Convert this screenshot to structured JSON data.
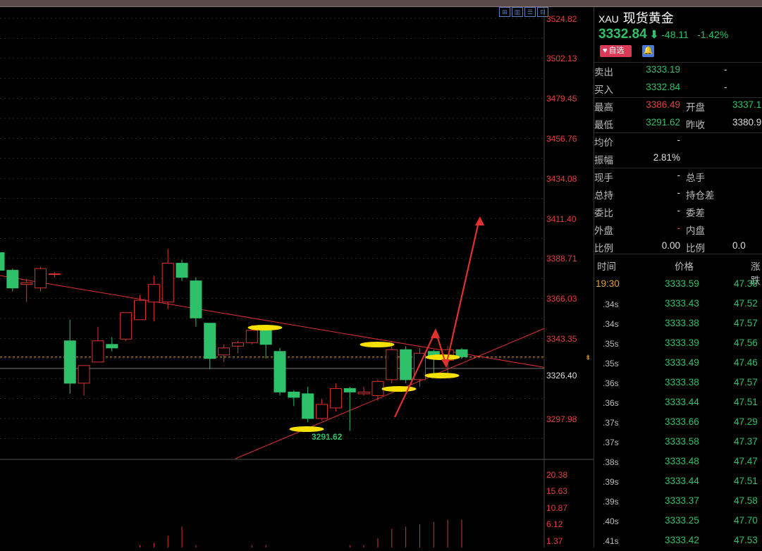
{
  "toolbar_icons": [
    "grid-icon",
    "chart-icon",
    "list-icon",
    "settings-icon"
  ],
  "axis": {
    "price_labels": [
      "3524.82",
      "3502.13",
      "3479.45",
      "3456.76",
      "3434.08",
      "3411.40",
      "3388.71",
      "3366.03",
      "3343.35",
      "3326.40",
      "3297.98"
    ],
    "volume_labels": [
      "20.38",
      "15.63",
      "10.87",
      "6.12",
      "1.37"
    ]
  },
  "annotation": {
    "low_label": "3291.62"
  },
  "quote": {
    "code": "XAU",
    "name": "现货黄金",
    "last": "3332.84",
    "change": "-48.11",
    "change_pct": "-1.42%",
    "fav_label": "自选",
    "rows": [
      {
        "l1": "卖出",
        "v1": "3333.19",
        "c1": "green",
        "v1b": "-",
        "l2": "",
        "v2": "",
        "c2": "white"
      },
      {
        "l1": "买入",
        "v1": "3332.84",
        "c1": "green",
        "v1b": "-",
        "l2": "",
        "v2": "",
        "c2": "white"
      },
      {
        "l1": "最高",
        "v1": "3386.49",
        "c1": "red",
        "v1b": "",
        "l2": "开盘",
        "v2": "3337.1",
        "c2": "green"
      },
      {
        "l1": "最低",
        "v1": "3291.62",
        "c1": "green",
        "v1b": "",
        "l2": "昨收",
        "v2": "3380.9",
        "c2": "white"
      },
      {
        "l1": "均价",
        "v1": "-",
        "c1": "white",
        "v1b": "",
        "l2": "",
        "v2": "",
        "c2": "white"
      },
      {
        "l1": "振幅",
        "v1": "2.81%",
        "c1": "white",
        "v1b": "",
        "l2": "",
        "v2": "",
        "c2": "white"
      },
      {
        "l1": "现手",
        "v1": "-",
        "c1": "white",
        "v1b": "",
        "l2": "总手",
        "v2": "",
        "c2": "white"
      },
      {
        "l1": "总持",
        "v1": "-",
        "c1": "white",
        "v1b": "",
        "l2": "持仓差",
        "v2": "",
        "c2": "white"
      },
      {
        "l1": "委比",
        "v1": "-",
        "c1": "white",
        "v1b": "",
        "l2": "委差",
        "v2": "",
        "c2": "white"
      },
      {
        "l1": "外盘",
        "v1": "-",
        "c1": "red",
        "v1b": "",
        "l2": "内盘",
        "v2": "",
        "c2": "white"
      },
      {
        "l1": "比例",
        "v1": "0.00",
        "c1": "white",
        "v1b": "",
        "l2": "比例",
        "v2": "0.0",
        "c2": "white"
      }
    ]
  },
  "ticks": {
    "headers": [
      "时间",
      "价格",
      "涨跌"
    ],
    "rows": [
      {
        "time": "19:30",
        "price": "3333.59",
        "chg": "47.36"
      },
      {
        "time": ".34s",
        "price": "3333.43",
        "chg": "47.52"
      },
      {
        "time": ".34s",
        "price": "3333.38",
        "chg": "47.57"
      },
      {
        "time": ".35s",
        "price": "3333.39",
        "chg": "47.56"
      },
      {
        "time": ".35s",
        "price": "3333.49",
        "chg": "47.46"
      },
      {
        "time": ".36s",
        "price": "3333.38",
        "chg": "47.57"
      },
      {
        "time": ".36s",
        "price": "3333.44",
        "chg": "47.51"
      },
      {
        "time": ".37s",
        "price": "3333.66",
        "chg": "47.29"
      },
      {
        "time": ".37s",
        "price": "3333.58",
        "chg": "47.37"
      },
      {
        "time": ".38s",
        "price": "3333.48",
        "chg": "47.47"
      },
      {
        "time": ".39s",
        "price": "3333.44",
        "chg": "47.51"
      },
      {
        "time": ".39s",
        "price": "3333.37",
        "chg": "47.58"
      },
      {
        "time": ".40s",
        "price": "3333.25",
        "chg": "47.70"
      },
      {
        "time": ".41s",
        "price": "3333.42",
        "chg": "47.53"
      }
    ]
  },
  "candles": [
    {
      "o": 3392,
      "h": 3396,
      "l": 3381,
      "c": 3382
    },
    {
      "o": 3382,
      "h": 3383,
      "l": 3370,
      "c": 3372
    },
    {
      "o": 3374,
      "h": 3377,
      "l": 3364,
      "c": 3375
    },
    {
      "o": 3372,
      "h": 3384,
      "l": 3370,
      "c": 3383
    },
    {
      "o": 3380,
      "h": 3381,
      "l": 3378,
      "c": 3380
    },
    {
      "o": 3342,
      "h": 3354,
      "l": 3312,
      "c": 3318
    },
    {
      "o": 3318,
      "h": 3320,
      "l": 3311,
      "c": 3328
    },
    {
      "o": 3330,
      "h": 3350,
      "l": 3330,
      "c": 3342
    },
    {
      "o": 3340,
      "h": 3344,
      "l": 3336,
      "c": 3338
    },
    {
      "o": 3343,
      "h": 3356,
      "l": 3342,
      "c": 3358
    },
    {
      "o": 3354,
      "h": 3368,
      "l": 3354,
      "c": 3365
    },
    {
      "o": 3364,
      "h": 3379,
      "l": 3353,
      "c": 3374
    },
    {
      "o": 3364,
      "h": 3394,
      "l": 3360,
      "c": 3386
    },
    {
      "o": 3386,
      "h": 3388,
      "l": 3376,
      "c": 3378
    },
    {
      "o": 3376,
      "h": 3378,
      "l": 3350,
      "c": 3355
    },
    {
      "o": 3352,
      "h": 3352,
      "l": 3326,
      "c": 3332
    },
    {
      "o": 3334,
      "h": 3340,
      "l": 3330,
      "c": 3338
    },
    {
      "o": 3339,
      "h": 3342,
      "l": 3335,
      "c": 3341
    },
    {
      "o": 3341,
      "h": 3351,
      "l": 3340,
      "c": 3348
    },
    {
      "o": 3348,
      "h": 3350,
      "l": 3332,
      "c": 3340
    },
    {
      "o": 3336,
      "h": 3338,
      "l": 3311,
      "c": 3313
    },
    {
      "o": 3313,
      "h": 3314,
      "l": 3305,
      "c": 3310
    },
    {
      "o": 3312,
      "h": 3316,
      "l": 3296,
      "c": 3298
    },
    {
      "o": 3298,
      "h": 3309,
      "l": 3297,
      "c": 3306
    },
    {
      "o": 3304,
      "h": 3318,
      "l": 3302,
      "c": 3315
    },
    {
      "o": 3315,
      "h": 3316,
      "l": 3291,
      "c": 3313
    },
    {
      "o": 3312,
      "h": 3316,
      "l": 3311,
      "c": 3313
    },
    {
      "o": 3311,
      "h": 3320,
      "l": 3308,
      "c": 3319
    },
    {
      "o": 3320,
      "h": 3342,
      "l": 3318,
      "c": 3337
    },
    {
      "o": 3337,
      "h": 3339,
      "l": 3318,
      "c": 3320
    },
    {
      "o": 3320,
      "h": 3338,
      "l": 3316,
      "c": 3335
    },
    {
      "o": 3336,
      "h": 3337,
      "l": 3323,
      "c": 3333
    },
    {
      "o": 3331,
      "h": 3339,
      "l": 3322,
      "c": 3337
    },
    {
      "o": 3337,
      "h": 3338,
      "l": 3332,
      "c": 3333
    }
  ],
  "volumes": [
    0,
    0,
    0,
    0,
    0,
    0,
    0,
    0,
    0,
    0,
    1,
    2,
    5,
    9,
    1,
    0,
    0,
    0,
    1,
    1,
    0,
    0,
    0,
    0,
    0,
    1,
    1,
    4,
    8,
    9,
    10,
    11,
    12,
    12
  ]
}
